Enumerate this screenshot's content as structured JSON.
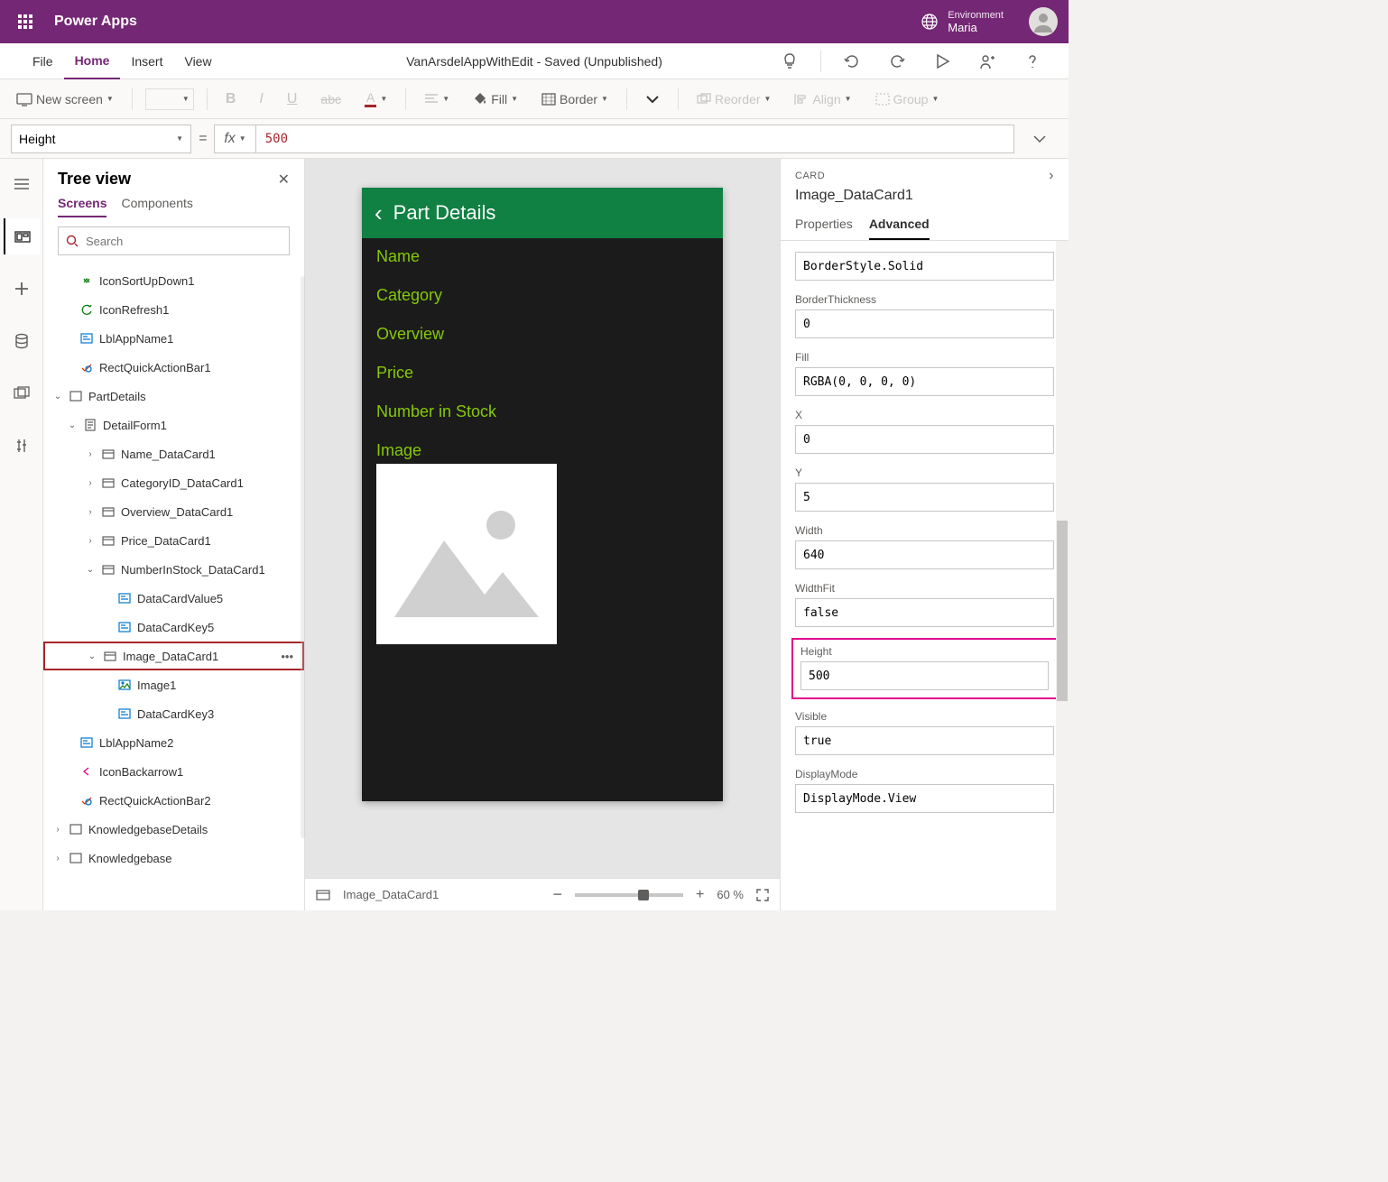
{
  "header": {
    "app_name": "Power Apps",
    "env_label": "Environment",
    "env_value": "Maria"
  },
  "menu": {
    "items": [
      "File",
      "Home",
      "Insert",
      "View"
    ],
    "active": "Home",
    "doc_title": "VanArsdelAppWithEdit - Saved (Unpublished)"
  },
  "toolbar": {
    "new_screen": "New screen",
    "fill": "Fill",
    "border": "Border",
    "reorder": "Reorder",
    "align": "Align",
    "group": "Group"
  },
  "formula": {
    "property": "Height",
    "fx": "fx",
    "value": "500"
  },
  "tree": {
    "title": "Tree view",
    "tabs": [
      "Screens",
      "Components"
    ],
    "search_placeholder": "Search",
    "nodes": {
      "n0": "IconSortUpDown1",
      "n1": "IconRefresh1",
      "n2": "LblAppName1",
      "n3": "RectQuickActionBar1",
      "n4": "PartDetails",
      "n5": "DetailForm1",
      "n6": "Name_DataCard1",
      "n7": "CategoryID_DataCard1",
      "n8": "Overview_DataCard1",
      "n9": "Price_DataCard1",
      "n10": "NumberInStock_DataCard1",
      "n11": "DataCardValue5",
      "n12": "DataCardKey5",
      "n13": "Image_DataCard1",
      "n14": "Image1",
      "n15": "DataCardKey3",
      "n16": "LblAppName2",
      "n17": "IconBackarrow1",
      "n18": "RectQuickActionBar2",
      "n19": "KnowledgebaseDetails",
      "n20": "Knowledgebase"
    }
  },
  "canvas": {
    "title": "Part Details",
    "fields": [
      "Name",
      "Category",
      "Overview",
      "Price",
      "Number in Stock",
      "Image"
    ],
    "footer_label": "Image_DataCard1",
    "zoom": "60  %"
  },
  "props": {
    "card": "CARD",
    "name": "Image_DataCard1",
    "tabs": [
      "Properties",
      "Advanced"
    ],
    "fields": {
      "borderstyle_v": "BorderStyle.Solid",
      "borderthickness": "BorderThickness",
      "borderthickness_v": "0",
      "fill": "Fill",
      "fill_v": "RGBA(0, 0, 0, 0)",
      "x": "X",
      "x_v": "0",
      "y": "Y",
      "y_v": "5",
      "width": "Width",
      "width_v": "640",
      "widthfit": "WidthFit",
      "widthfit_v": "false",
      "height": "Height",
      "height_v": "500",
      "visible": "Visible",
      "visible_v": "true",
      "displaymode": "DisplayMode",
      "displaymode_v": "DisplayMode.View"
    }
  }
}
